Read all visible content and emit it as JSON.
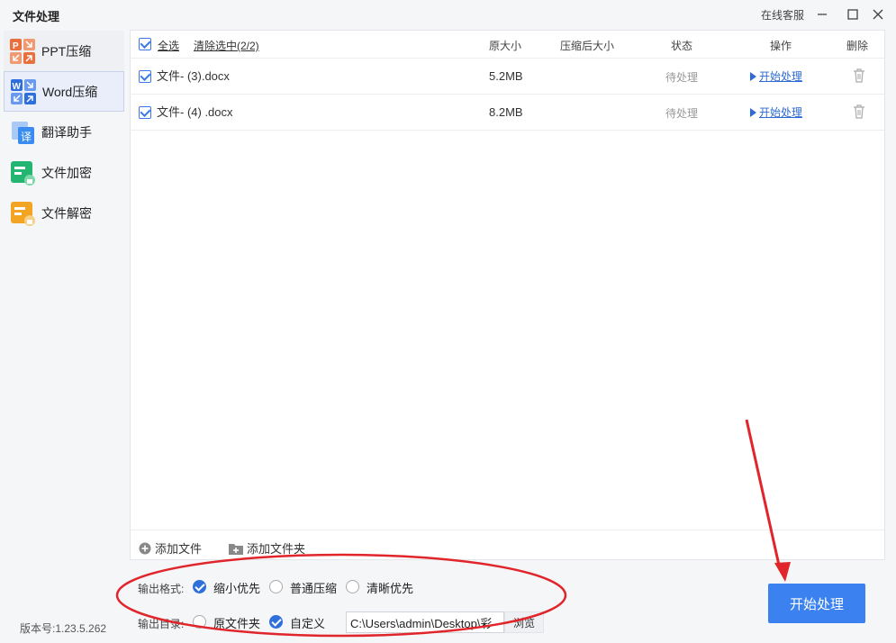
{
  "window": {
    "title": "文件处理",
    "support": "在线客服",
    "minimize_icon": "minimize-icon",
    "maximize_icon": "maximize-icon",
    "close_icon": "close-icon"
  },
  "sidebar": {
    "items": [
      {
        "label": "PPT压缩",
        "icon": "ppt-compress-icon",
        "color": "#e9703c"
      },
      {
        "label": "Word压缩",
        "icon": "word-compress-icon",
        "color": "#2f6fdc"
      },
      {
        "label": "翻译助手",
        "icon": "translate-icon",
        "color": "#3b8cf0"
      },
      {
        "label": "文件加密",
        "icon": "file-encrypt-icon",
        "color": "#24b573"
      },
      {
        "label": "文件解密",
        "icon": "file-decrypt-icon",
        "color": "#f4a423"
      }
    ],
    "active_index": 1,
    "version": "版本号:1.23.5.262"
  },
  "table": {
    "select_all": "全选",
    "clear_selected": "清除选中(2/2)",
    "columns": [
      "原大小",
      "压缩后大小",
      "状态",
      "操作",
      "删除"
    ],
    "rows": [
      {
        "name": "文件- (3).docx",
        "size": "5.2MB",
        "compressed": "",
        "status": "待处理",
        "action": "开始处理"
      },
      {
        "name": "文件- (4) .docx",
        "size": "8.2MB",
        "compressed": "",
        "status": "待处理",
        "action": "开始处理"
      }
    ]
  },
  "footer": {
    "add_file": "添加文件",
    "add_folder": "添加文件夹"
  },
  "options": {
    "format_label": "输出格式:",
    "formats": [
      "缩小优先",
      "普通压缩",
      "清晰优先"
    ],
    "format_selected": 0,
    "dir_label": "输出目录:",
    "dirs": [
      "原文件夹",
      "自定义"
    ],
    "dir_selected": 1,
    "path": "C:\\Users\\admin\\Desktop\\彩",
    "browse": "浏览"
  },
  "start_button": "开始处理",
  "colors": {
    "accent": "#3b82f0",
    "annotation": "#e0252b"
  }
}
